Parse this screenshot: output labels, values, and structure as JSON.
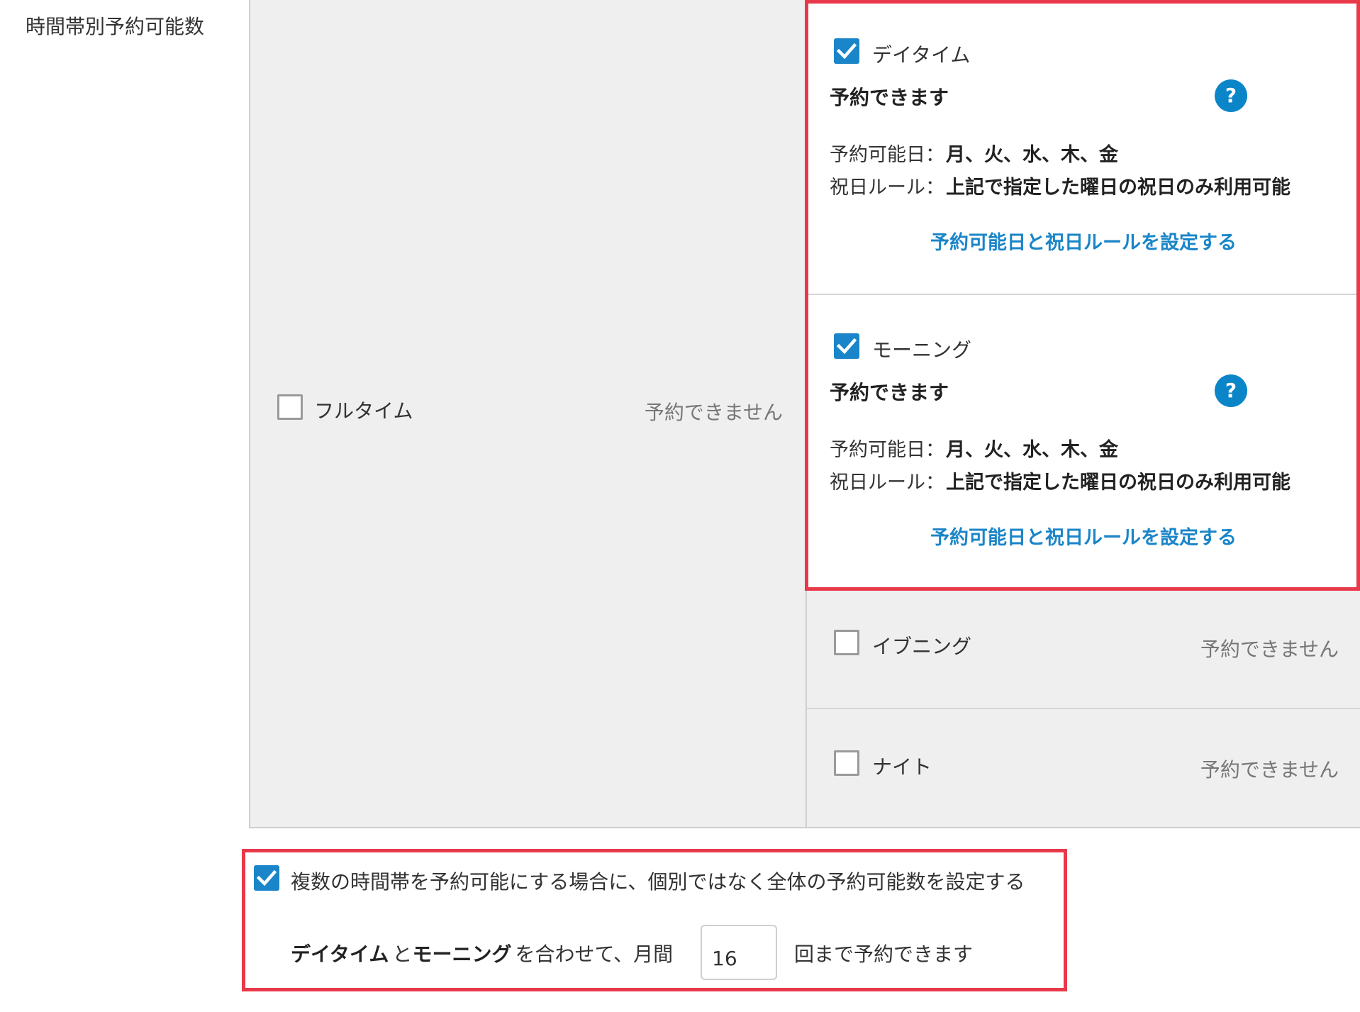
{
  "section": {
    "label": "時間帯別予約可能数"
  },
  "fulltime": {
    "label": "フルタイム",
    "status": "予約できません",
    "checked": false
  },
  "daytime": {
    "label": "デイタイム",
    "checked": true,
    "status": "予約できます",
    "help_icon": "question-mark-icon",
    "days_key": "予約可能日：",
    "days_value": "月、火、水、木、金",
    "holiday_key": "祝日ルール：",
    "holiday_value": "上記で指定した曜日の祝日のみ利用可能",
    "link": "予約可能日と祝日ルールを設定する"
  },
  "morning": {
    "label": "モーニング",
    "checked": true,
    "status": "予約できます",
    "help_icon": "question-mark-icon",
    "days_key": "予約可能日：",
    "days_value": "月、火、水、木、金",
    "holiday_key": "祝日ルール：",
    "holiday_value": "上記で指定した曜日の祝日のみ利用可能",
    "link": "予約可能日と祝日ルールを設定する"
  },
  "evening": {
    "label": "イブニング",
    "status": "予約できません",
    "checked": false
  },
  "night": {
    "label": "ナイト",
    "status": "予約できません",
    "checked": false
  },
  "combined": {
    "checked": true,
    "label": "複数の時間帯を予約可能にする場合に、個別ではなく全体の予約可能数を設定する",
    "slot_a": "デイタイム",
    "connector": "と",
    "slot_b": "モーニング",
    "middle_text": "を合わせて、月間",
    "count": "16",
    "suffix_text": "回まで予約できます"
  },
  "colors": {
    "accent": "#1a85c8",
    "highlight": "#e8394a",
    "panel": "#efefef"
  }
}
